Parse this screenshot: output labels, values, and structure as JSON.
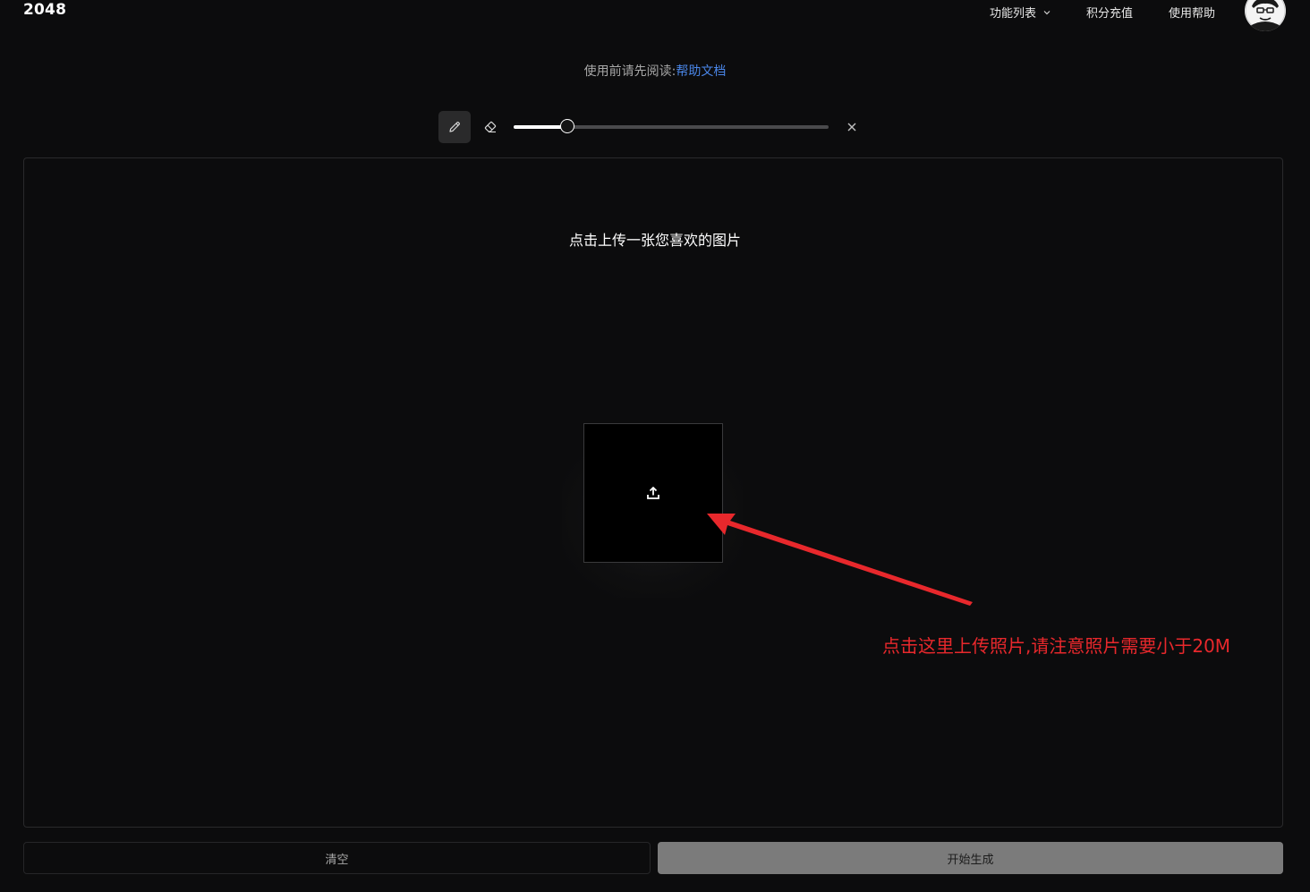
{
  "header": {
    "logo": "2048",
    "nav": {
      "features": "功能列表",
      "recharge": "积分充值",
      "help": "使用帮助"
    }
  },
  "notice": {
    "prefix": "使用前请先阅读:",
    "link": "帮助文档"
  },
  "toolbar": {
    "brush_size_fraction": 0.17
  },
  "panel": {
    "title": "点击上传一张您喜欢的图片"
  },
  "annotation": {
    "text": "点击这里上传照片,请注意照片需要小于20M",
    "color": "#e8282c"
  },
  "actions": {
    "clear_label": "清空",
    "generate_label": "开始生成"
  },
  "colors": {
    "background": "#0c0c0d",
    "link": "#4a86e8",
    "generate_button": "#7b7b7b"
  },
  "icons": {
    "chevron": "chevron-down-icon",
    "pen": "pencil-icon",
    "eraser": "eraser-icon",
    "close": "close-icon",
    "upload": "upload-icon"
  }
}
